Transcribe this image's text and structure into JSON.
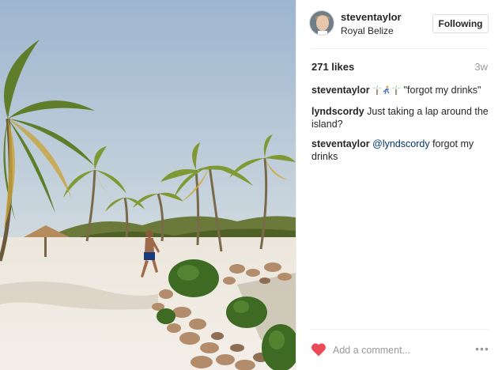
{
  "post": {
    "author": {
      "username": "steventaylor",
      "location": "Royal Belize",
      "follow_label": "Following"
    },
    "likes_text": "271 likes",
    "time_ago": "3w",
    "comments": [
      {
        "user": "steventaylor",
        "pre_text": "",
        "emoji": [
          "palm-tree-icon",
          "person-running-icon",
          "palm-tree-icon"
        ],
        "text": "\"forgot my drinks\""
      },
      {
        "user": "lyndscordy",
        "text": "Just taking a lap around the island?"
      },
      {
        "user": "steventaylor",
        "mention": "@lyndscordy",
        "text": "forgot my drinks"
      }
    ],
    "comment_box": {
      "placeholder": "Add a comment..."
    },
    "more_label": "•••"
  },
  "colors": {
    "heart": "#ed4956",
    "link": "#003569",
    "muted": "#999999",
    "text": "#262626"
  }
}
